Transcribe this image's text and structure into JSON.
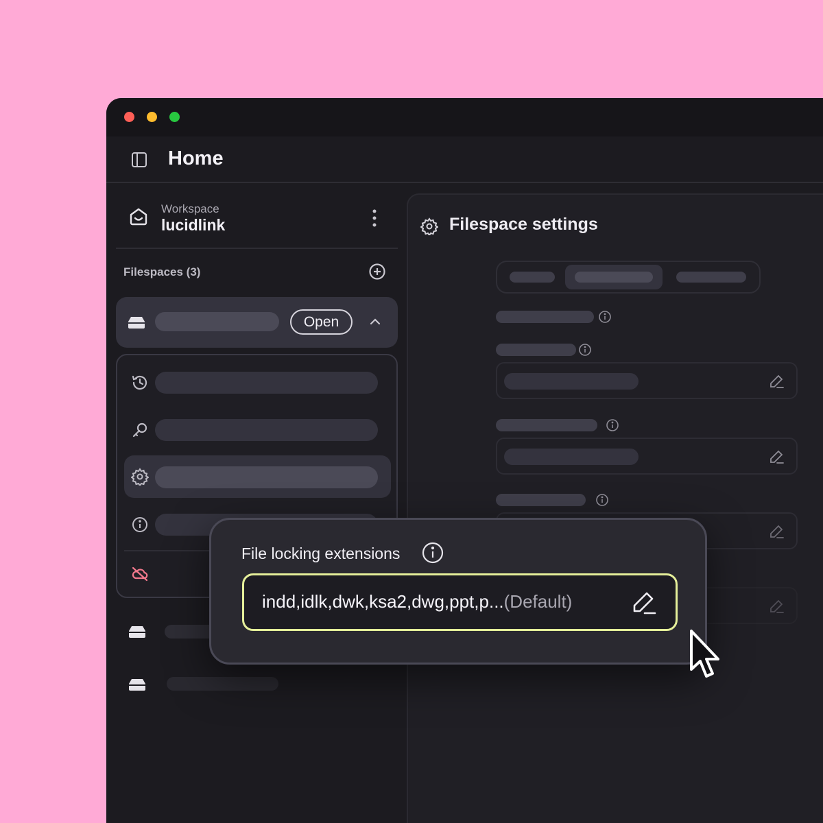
{
  "window": {
    "traffic_lights": {
      "close": "#fe5f57",
      "minimize": "#febc2e",
      "zoom": "#28c840"
    }
  },
  "header": {
    "title": "Home",
    "sidebar_toggle_icon": "sidebar-toggle-icon"
  },
  "sidebar": {
    "workspace": {
      "label": "Workspace",
      "name": "lucidlink",
      "icon": "home-icon",
      "menu_icon": "kebab-menu-icon"
    },
    "filespaces_header": "Filespaces (3)",
    "add_icon": "add-circle-icon",
    "active_filespace": {
      "open_label": "Open",
      "icon": "drive-icon",
      "expand_icon": "chevron-up-icon"
    },
    "submenu_icons": [
      "history-icon",
      "key-icon",
      "gear-icon",
      "info-icon",
      "cloud-off-icon"
    ]
  },
  "settings_panel": {
    "title": "Filespace settings",
    "icon": "gear-icon"
  },
  "popover": {
    "label": "File locking extensions",
    "value": "indd,idlk,dwk,ksa2,dwg,ppt,p...",
    "default_tag": "(Default)",
    "info_icon": "info-icon",
    "edit_icon": "pencil-icon"
  },
  "colors": {
    "background": "#ffaad6",
    "window": "#1c1b20",
    "input_focus_border": "#e5ef9a",
    "disconnect_icon": "#f2788c"
  }
}
